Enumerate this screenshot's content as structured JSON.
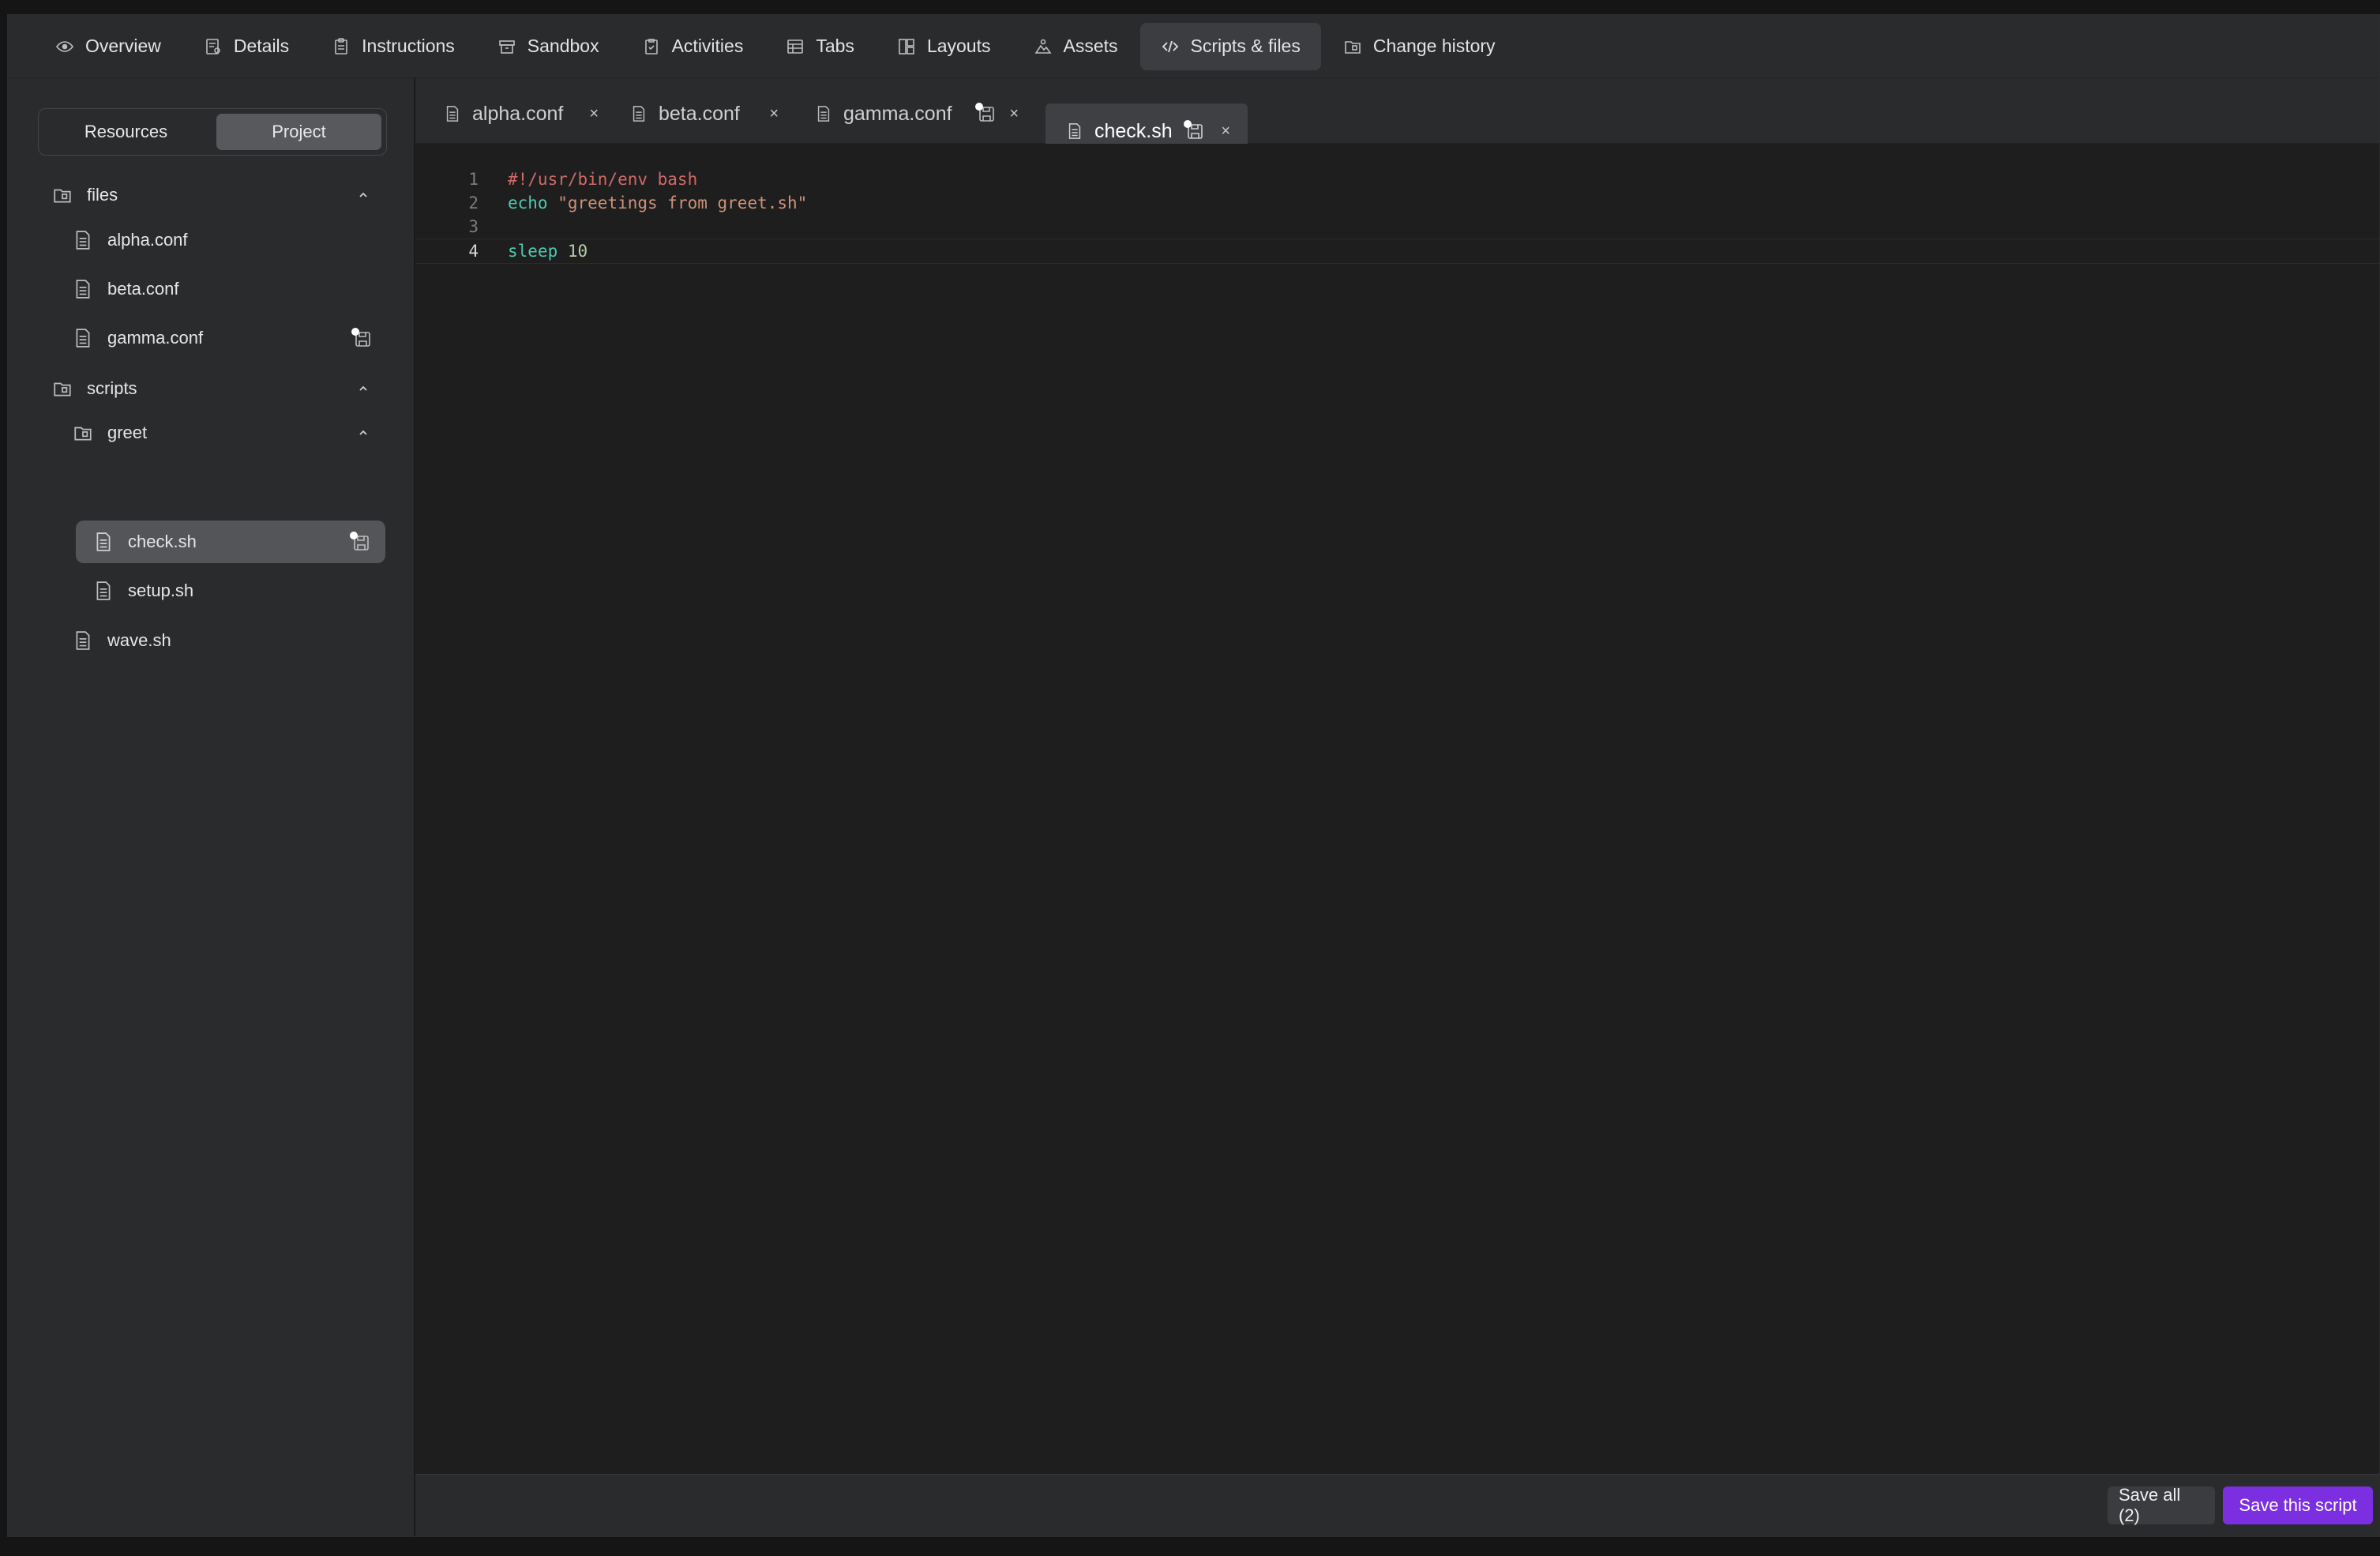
{
  "nav": {
    "items": [
      {
        "label": "Overview",
        "icon": "eye-icon"
      },
      {
        "label": "Details",
        "icon": "details-icon"
      },
      {
        "label": "Instructions",
        "icon": "clipboard-icon"
      },
      {
        "label": "Sandbox",
        "icon": "sandbox-icon"
      },
      {
        "label": "Activities",
        "icon": "checklist-icon"
      },
      {
        "label": "Tabs",
        "icon": "tabs-icon"
      },
      {
        "label": "Layouts",
        "icon": "layout-icon"
      },
      {
        "label": "Assets",
        "icon": "assets-icon"
      },
      {
        "label": "Scripts & files",
        "icon": "code-icon"
      },
      {
        "label": "Change history",
        "icon": "history-icon"
      }
    ],
    "active": "Scripts & files"
  },
  "sidebar": {
    "segments": [
      "Resources",
      "Project"
    ],
    "active_segment": "Project",
    "tree": {
      "files_folder": "files",
      "files": [
        "alpha.conf",
        "beta.conf",
        "gamma.conf"
      ],
      "scripts_folder": "scripts",
      "greet_folder": "greet",
      "greet_files": [
        "check.sh",
        "setup.sh"
      ],
      "script_files": [
        "wave.sh"
      ]
    },
    "selected": "check.sh",
    "modified": [
      "gamma.conf",
      "check.sh"
    ]
  },
  "editor": {
    "tabs": [
      {
        "label": "alpha.conf",
        "modified": false
      },
      {
        "label": "beta.conf",
        "modified": false
      },
      {
        "label": "gamma.conf",
        "modified": true
      },
      {
        "label": "check.sh",
        "modified": true
      }
    ],
    "active_tab": "check.sh",
    "close_glyph": "×",
    "line_numbers": [
      "1",
      "2",
      "3",
      "4"
    ],
    "current_line": 4,
    "lines": {
      "l1": {
        "shebang": "#!/usr/bin/env bash"
      },
      "l2": {
        "cmd": "echo",
        "str": "\"greetings from greet.sh\""
      },
      "l3": {},
      "l4": {
        "cmd": "sleep",
        "num": "10"
      }
    }
  },
  "footer": {
    "save_all_label": "Save all (2)",
    "save_script_label": "Save this script"
  },
  "colors": {
    "accent": "#7c2fe0",
    "background": "#1e1e1e",
    "panel": "#2a2b2d",
    "syntax_keyword": "#4ec9b0",
    "syntax_string": "#ce9178",
    "syntax_shebang": "#d16969"
  }
}
